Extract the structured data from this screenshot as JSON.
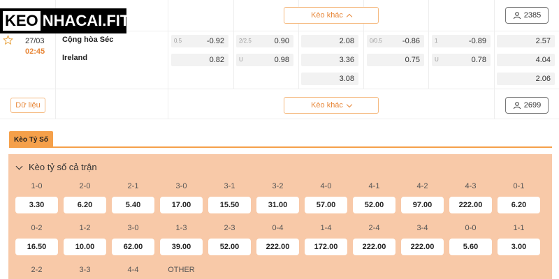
{
  "logo": {
    "part1": "KEO",
    "part2": "NHACAI.FIT"
  },
  "top_row": {
    "more_odds_label": "Kèo khác",
    "count": "2385"
  },
  "match": {
    "date": "27/03",
    "time": "02:45",
    "home_team": "Cộng hòa Séc",
    "away_team": "Ireland",
    "odds": {
      "col1": [
        {
          "label": "0.5",
          "value": "-0.92"
        },
        {
          "label": "",
          "value": "0.82"
        }
      ],
      "col2": [
        {
          "label": "2/2.5",
          "value": "0.90"
        },
        {
          "label": "U",
          "value": "0.98"
        }
      ],
      "col3": [
        {
          "label": "",
          "value": "2.08"
        },
        {
          "label": "",
          "value": "3.36"
        },
        {
          "label": "",
          "value": "3.08"
        }
      ],
      "col4": [
        {
          "label": "0/0.5",
          "value": "-0.86"
        },
        {
          "label": "",
          "value": "0.75"
        }
      ],
      "col5": [
        {
          "label": "1",
          "value": "-0.89"
        },
        {
          "label": "U",
          "value": "0.78"
        }
      ],
      "col6": [
        {
          "label": "",
          "value": "2.57"
        },
        {
          "label": "",
          "value": "4.04"
        },
        {
          "label": "",
          "value": "2.06"
        }
      ]
    },
    "data_button": "Dữ liệu",
    "more_odds_label": "Kèo khác",
    "count": "2699"
  },
  "tabs": {
    "active": "Kèo Tỷ Số"
  },
  "correct_score": {
    "title": "Kèo tỷ số cả trận",
    "rows": [
      [
        {
          "score": "1-0",
          "odd": "3.30"
        },
        {
          "score": "2-0",
          "odd": "6.20"
        },
        {
          "score": "2-1",
          "odd": "5.40"
        },
        {
          "score": "3-0",
          "odd": "17.00"
        },
        {
          "score": "3-1",
          "odd": "15.50"
        },
        {
          "score": "3-2",
          "odd": "31.00"
        },
        {
          "score": "4-0",
          "odd": "57.00"
        },
        {
          "score": "4-1",
          "odd": "52.00"
        },
        {
          "score": "4-2",
          "odd": "97.00"
        },
        {
          "score": "4-3",
          "odd": "222.00"
        },
        {
          "score": "0-1",
          "odd": "6.20"
        }
      ],
      [
        {
          "score": "0-2",
          "odd": "16.50"
        },
        {
          "score": "1-2",
          "odd": "10.00"
        },
        {
          "score": "3-0",
          "odd": "62.00"
        },
        {
          "score": "1-3",
          "odd": "39.00"
        },
        {
          "score": "2-3",
          "odd": "52.00"
        },
        {
          "score": "0-4",
          "odd": "222.00"
        },
        {
          "score": "1-4",
          "odd": "172.00"
        },
        {
          "score": "2-4",
          "odd": "222.00"
        },
        {
          "score": "3-4",
          "odd": "222.00"
        },
        {
          "score": "0-0",
          "odd": "5.60"
        },
        {
          "score": "1-1",
          "odd": "3.00"
        }
      ],
      [
        {
          "score": "2-2",
          "odd": ""
        },
        {
          "score": "3-3",
          "odd": ""
        },
        {
          "score": "4-4",
          "odd": ""
        },
        {
          "score": "OTHER",
          "odd": ""
        }
      ]
    ]
  },
  "colors": {
    "accent": "#f5a04a",
    "panel_bg": "#f8c9a8",
    "time": "#e8883a"
  }
}
